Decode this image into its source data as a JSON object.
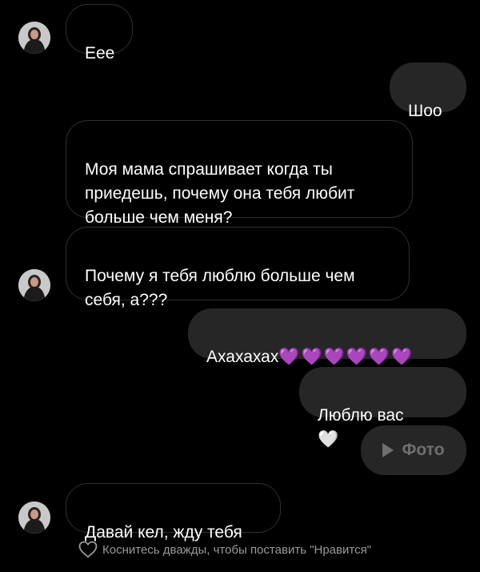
{
  "messages": [
    {
      "id": "m1",
      "direction": "incoming",
      "text": "Еее"
    },
    {
      "id": "m2",
      "direction": "outgoing",
      "text": "Шоо"
    },
    {
      "id": "m3",
      "direction": "incoming",
      "text": "Моя мама спрашивает когда ты\nприедешь, почему она тебя любит\nбольше чем меня?"
    },
    {
      "id": "m4",
      "direction": "incoming",
      "text": "Почему я тебя люблю больше чем\nсебя, а???"
    },
    {
      "id": "m5",
      "direction": "outgoing",
      "text": "Ахахахах",
      "emoji": "💜💜💜💜💜💜"
    },
    {
      "id": "m6",
      "direction": "outgoing",
      "text": "Люблю вас",
      "emoji": "🤍"
    },
    {
      "id": "m7",
      "direction": "outgoing",
      "type": "photo",
      "label": "Фото",
      "icon": "play-icon"
    },
    {
      "id": "m8",
      "direction": "incoming",
      "text": "Давай кел, жду тебя"
    }
  ],
  "like_hint": {
    "icon": "heart-outline-icon",
    "text": "Коснитесь дважды, чтобы поставить \"Нравится\""
  },
  "colors": {
    "background": "#000000",
    "outgoing_bubble": "#262626",
    "incoming_border": "#2f2f2f",
    "purple_heart": "#9b4dff"
  }
}
